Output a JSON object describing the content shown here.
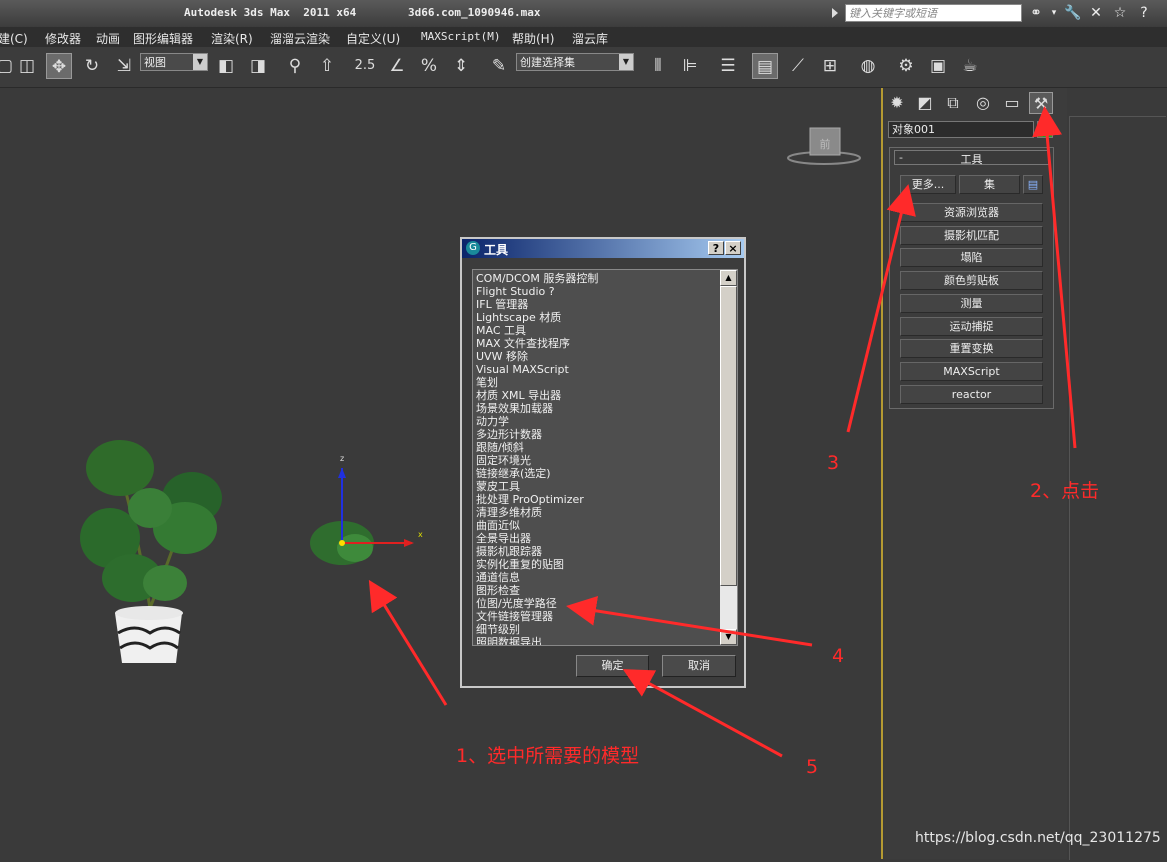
{
  "app": {
    "title": "Autodesk 3ds Max  2011 x64",
    "file": "3d66.com_1090946.max",
    "search_placeholder": "键入关键字或短语"
  },
  "menu": [
    "建(C)",
    "修改器",
    "动画",
    "图形编辑器",
    "渲染(R)",
    "溜溜云渲染",
    "自定义(U)",
    "MAXScript(M)",
    "帮助(H)",
    "溜云库"
  ],
  "toolbar": {
    "view_dropdown": "视图",
    "spinner_label": "2.5",
    "selection_set_dropdown": "创建选择集"
  },
  "viewport": {
    "viewcube_label": "前"
  },
  "command_panel": {
    "object_name": "对象001",
    "object_color": "#1ea81e",
    "rollout_title": "工具",
    "rollout_toggle": "-",
    "more_button": "更多...",
    "sets_button": "集",
    "utilities": [
      "资源浏览器",
      "摄影机匹配",
      "塌陷",
      "颜色剪贴板",
      "测量",
      "运动捕捉",
      "重置变换",
      "MAXScript",
      "reactor"
    ]
  },
  "dialog": {
    "title": "工具",
    "help_btn": "?",
    "close_btn": "×",
    "items": [
      "COM/DCOM 服务器控制",
      "Flight Studio ?",
      "IFL 管理器",
      "Lightscape 材质",
      "MAC 工具",
      "MAX 文件查找程序",
      "UVW 移除",
      "Visual MAXScript",
      "笔划",
      "材质 XML 导出器",
      "场景效果加载器",
      "动力学",
      "多边形计数器",
      "跟随/倾斜",
      "固定环境光",
      "链接继承(选定)",
      "蒙皮工具",
      "批处理 ProOptimizer",
      "清理多维材质",
      "曲面近似",
      "全景导出器",
      "摄影机跟踪器",
      "实例化重复的贴图",
      "通道信息",
      "图形检查",
      "位图/光度学路径",
      "文件链接管理器",
      "细节级别",
      "照明数据导出"
    ],
    "ok": "确定",
    "cancel": "取消"
  },
  "annotations": {
    "step1": "1、选中所需要的模型",
    "step2": "2、点击",
    "step3": "3",
    "step4": "4",
    "step5": "5",
    "color": "#ff2a2a"
  },
  "watermark": "https://blog.csdn.net/qq_23011275"
}
